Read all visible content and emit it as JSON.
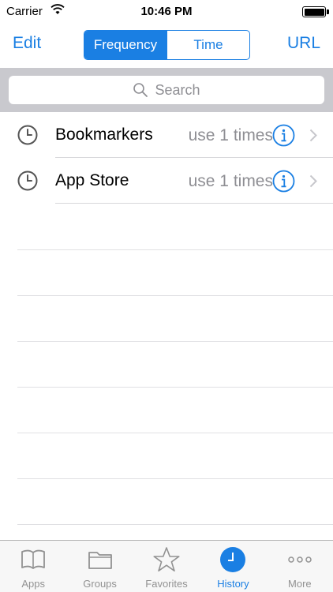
{
  "status_bar": {
    "carrier": "Carrier",
    "time": "10:46 PM"
  },
  "nav": {
    "edit_label": "Edit",
    "url_label": "URL",
    "segments": [
      {
        "label": "Frequency",
        "selected": true
      },
      {
        "label": "Time",
        "selected": false
      }
    ]
  },
  "search": {
    "placeholder": "Search"
  },
  "history": [
    {
      "title": "Bookmarkers",
      "usage": "use 1 times",
      "icon": "clock-icon"
    },
    {
      "title": "App Store",
      "usage": "use 1 times",
      "icon": "clock-icon"
    }
  ],
  "tab_bar": {
    "tabs": [
      {
        "label": "Apps",
        "icon": "book-icon",
        "active": false
      },
      {
        "label": "Groups",
        "icon": "folder-icon",
        "active": false
      },
      {
        "label": "Favorites",
        "icon": "star-icon",
        "active": false
      },
      {
        "label": "History",
        "icon": "clock-icon",
        "active": true
      },
      {
        "label": "More",
        "icon": "more-dots-icon",
        "active": false
      }
    ]
  },
  "colors": {
    "accent": "#1a7fe3",
    "secondary_text": "#8e8e93",
    "search_bar_bg": "#c9c9ce"
  }
}
